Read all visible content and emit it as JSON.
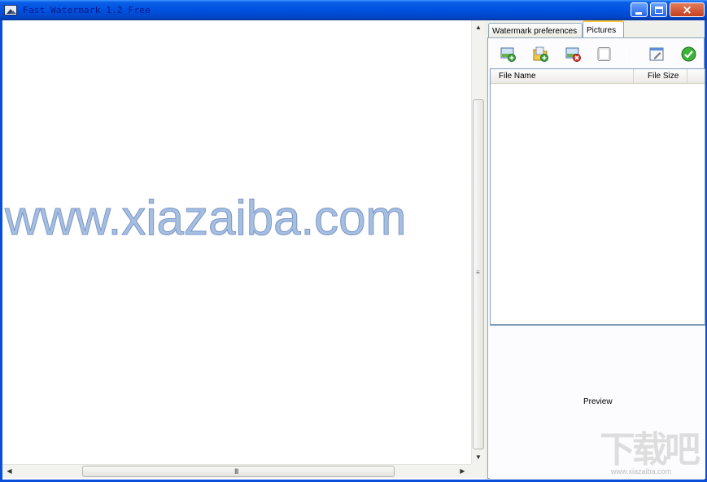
{
  "window": {
    "title": "Fast Watermark 1.2 Free",
    "minimize_icon": "minimize-icon",
    "maximize_icon": "maximize-icon",
    "close_glyph": "×"
  },
  "canvas": {
    "watermark_text": "www.xiazaiba.com",
    "watermark_color": "#a6bee0"
  },
  "scrollbars": {
    "up_glyph": "▲",
    "down_glyph": "▼",
    "left_glyph": "◀",
    "right_glyph": "▶",
    "v_grip": "≡",
    "h_grip": "III"
  },
  "tabs": [
    {
      "label": "Watermark preferences",
      "active": false
    },
    {
      "label": "Pictures",
      "active": true
    }
  ],
  "toolbar": {
    "buttons": [
      {
        "icon": "add-image-icon"
      },
      {
        "icon": "add-folder-icon"
      },
      {
        "icon": "remove-image-icon"
      },
      {
        "icon": "clear-list-icon"
      },
      {
        "icon": "edit-icon"
      },
      {
        "icon": "apply-check-icon"
      }
    ]
  },
  "file_list": {
    "columns": [
      "File Name",
      "File Size"
    ],
    "rows": []
  },
  "preview": {
    "label": "Preview"
  },
  "site_logo": {
    "text": "下载吧",
    "url": "www.xiazaiba.com"
  }
}
